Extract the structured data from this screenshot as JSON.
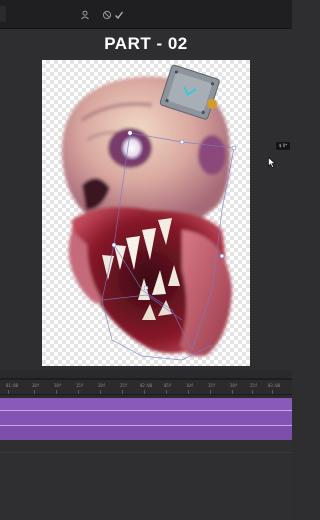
{
  "title": "PART - 02",
  "toolbar": {
    "icons": [
      "user-icon",
      "cancel-icon",
      "checkmark-icon"
    ]
  },
  "side_badge": "$ 0*",
  "timeline": {
    "ticks": [
      "01:00",
      "30f",
      "10f",
      "15f",
      "20f",
      "25f",
      "02:00",
      "05f",
      "10f",
      "15f",
      "20f",
      "25f",
      "03:00"
    ]
  },
  "colors": {
    "track": "#8a5ab8",
    "background": "#2e2e30",
    "title": "#ffffff"
  }
}
